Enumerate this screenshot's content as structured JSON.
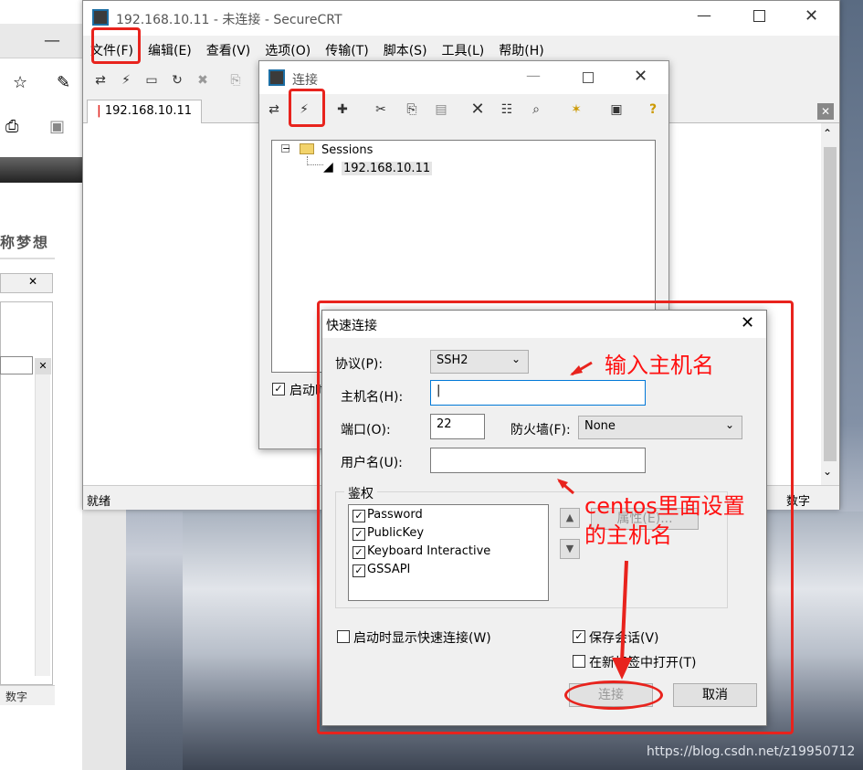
{
  "left_app": {
    "title_fragment": "称梦想",
    "status": "数字"
  },
  "main_window": {
    "title": "192.168.10.11 - 未连接 - SecureCRT",
    "menu": [
      "文件(F)",
      "编辑(E)",
      "查看(V)",
      "选项(O)",
      "传输(T)",
      "脚本(S)",
      "工具(L)",
      "帮助(H)"
    ],
    "tab": "192.168.10.11",
    "status_left": "就绪",
    "status_right": "数字"
  },
  "connect_dialog": {
    "title": "连接",
    "tree_root": "Sessions",
    "tree_child": "192.168.10.11",
    "startup_checkbox_label": "启动时"
  },
  "quick_connect": {
    "title": "快速连接",
    "protocol_label": "协议(P):",
    "protocol_value": "SSH2",
    "hostname_label": "主机名(H):",
    "hostname_value": "",
    "port_label": "端口(O):",
    "port_value": "22",
    "firewall_label": "防火墙(F):",
    "firewall_value": "None",
    "username_label": "用户名(U):",
    "username_value": "",
    "auth_group": "鉴权",
    "auth_items": [
      {
        "label": "Password",
        "checked": true
      },
      {
        "label": "PublicKey",
        "checked": true
      },
      {
        "label": "Keyboard Interactive",
        "checked": true
      },
      {
        "label": "GSSAPI",
        "checked": true
      }
    ],
    "properties_button": "属性(E)...",
    "show_on_startup": "启动时显示快速连接(W)",
    "save_session": "保存会话(V)",
    "open_in_tab": "在新标签中打开(T)",
    "connect_button": "连接",
    "cancel_button": "取消"
  },
  "annotations": {
    "enter_hostname": "输入主机名",
    "centos_hostname_line1": "centos里面设置",
    "centos_hostname_line2": "的主机名"
  },
  "watermark": "https://blog.csdn.net/z19950712",
  "colors": {
    "highlight_red": "#e8231d"
  }
}
